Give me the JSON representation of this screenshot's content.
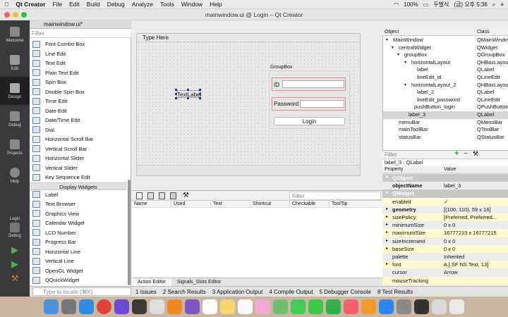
{
  "menubar": {
    "app": "Qt Creator",
    "items": [
      "File",
      "Edit",
      "Build",
      "Debug",
      "Analyze",
      "Tools",
      "Window",
      "Help"
    ],
    "battery": "100%",
    "input": "두벌식",
    "clock": "(금) 오후 5:36"
  },
  "window": {
    "title": "mainwindow.ui @ Login – Qt Creator",
    "file_tab": "mainwindow.ui*"
  },
  "modes": [
    "Welcome",
    "Edit",
    "Design",
    "Debug",
    "Projects",
    "Help"
  ],
  "kit": {
    "project": "Login",
    "config": "Debug"
  },
  "widgetbox": {
    "filter_placeholder": "Filter",
    "items_top": [
      "Font Combo Box",
      "Line Edit",
      "Text Edit",
      "Plain Text Edit",
      "Spin Box",
      "Double Spin Box",
      "Time Edit",
      "Date Edit",
      "Date/Time Edit",
      "Dial",
      "Horizontal Scroll Bar",
      "Vertical Scroll Bar",
      "Horizontal Slider",
      "Vertical Slider",
      "Key Sequence Edit"
    ],
    "category": "Display Widgets",
    "items_bottom": [
      "Label",
      "Text Browser",
      "Graphics View",
      "Calendar Widget",
      "LCD Number",
      "Progress Bar",
      "Horizontal Line",
      "Vertical Line",
      "OpenGL Widget",
      "QQuickWidget"
    ]
  },
  "form": {
    "menu_placeholder": "Type Here",
    "label3_text": "TextLabel",
    "groupbox_title": "GroupBox",
    "id_label": "ID",
    "password_label": "Password",
    "login_button": "Login"
  },
  "action_editor": {
    "filter_placeholder": "Filter",
    "columns": [
      "Name",
      "Used",
      "Text",
      "Shortcut",
      "Checkable",
      "ToolTip"
    ],
    "tabs": [
      "Action Editor",
      "Signals_Slots Editor"
    ]
  },
  "object_inspector": {
    "columns": [
      "Object",
      "Class"
    ],
    "rows": [
      {
        "name": "MainWindow",
        "cls": "QMainWindow"
      },
      {
        "name": "centralWidget",
        "cls": "QWidget"
      },
      {
        "name": "groupBox",
        "cls": "QGroupBox"
      },
      {
        "name": "horizontalLayout",
        "cls": "QHBoxLayout"
      },
      {
        "name": "label",
        "cls": "QLabel"
      },
      {
        "name": "lineEdit_id",
        "cls": "QLineEdit"
      },
      {
        "name": "horizontalLayout_2",
        "cls": "QHBoxLayout"
      },
      {
        "name": "label_2",
        "cls": "QLabel"
      },
      {
        "name": "lineEdit_password",
        "cls": "QLineEdit"
      },
      {
        "name": "pushButton_login",
        "cls": "QPushButton"
      },
      {
        "name": "label_3",
        "cls": "QLabel"
      },
      {
        "name": "menuBar",
        "cls": "QMenuBar"
      },
      {
        "name": "mainToolBar",
        "cls": "QToolBar"
      },
      {
        "name": "statusBar",
        "cls": "QStatusBar"
      }
    ]
  },
  "property_editor": {
    "filter_placeholder": "Filter",
    "object_line": "label_3 : QLabel",
    "columns": [
      "Property",
      "Value"
    ],
    "rows": [
      {
        "name": "QObject",
        "value": "",
        "cat": true
      },
      {
        "name": "objectName",
        "value": "label_3",
        "bold": true
      },
      {
        "name": "QWidget",
        "value": "",
        "cat": true
      },
      {
        "name": "enabled",
        "value": "✓"
      },
      {
        "name": "geometry",
        "value": "[(100, 110), 59 x 16]",
        "bold": true
      },
      {
        "name": "sizePolicy",
        "value": "[Preferred, Preferred..."
      },
      {
        "name": "minimumSize",
        "value": "0 x 0"
      },
      {
        "name": "maximumSize",
        "value": "16777215 x 16777215"
      },
      {
        "name": "sizeIncrement",
        "value": "0 x 0"
      },
      {
        "name": "baseSize",
        "value": "0 x 0"
      },
      {
        "name": "palette",
        "value": "Inherited"
      },
      {
        "name": "font",
        "value": "A  [.SF NS Text, 13]"
      },
      {
        "name": "cursor",
        "value": "Arrow"
      },
      {
        "name": "mouseTracking",
        "value": ""
      }
    ]
  },
  "output_bar": {
    "locator_placeholder": "Type to locate (⌘K)",
    "tabs": [
      "1 Issues",
      "2 Search Results",
      "3 Application Output",
      "4 Compile Output",
      "5 Debugger Console",
      "8 Test Results"
    ]
  },
  "colors": {
    "modebar": "#3a3a3a",
    "dock": "#c9b7a2",
    "selection": "#d6d6d6"
  }
}
